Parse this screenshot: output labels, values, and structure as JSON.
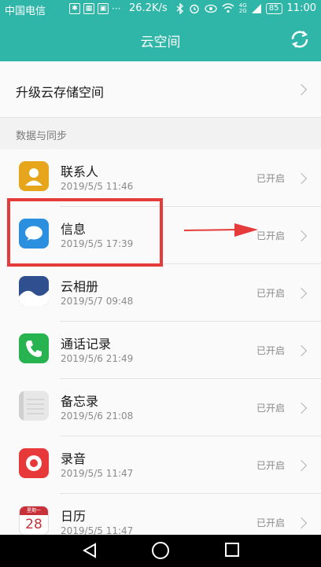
{
  "status_bar": {
    "carrier": "中国电信",
    "speed": "26.2K/s",
    "network": "4G 2G",
    "battery": "85",
    "time": "11:00"
  },
  "app_bar": {
    "title": "云空间",
    "sync_icon": "refresh-icon"
  },
  "upgrade": {
    "label": "升级云存储空间"
  },
  "section": {
    "label": "数据与同步"
  },
  "items": [
    {
      "name": "联系人",
      "time": "2019/5/5 11:46",
      "status": "已开启",
      "icon": "contacts-icon",
      "color": "#e6a51b"
    },
    {
      "name": "信息",
      "time": "2019/5/5 17:39",
      "status": "已开启",
      "icon": "message-icon",
      "color": "#2b8fe0"
    },
    {
      "name": "云相册",
      "time": "2019/5/7 09:48",
      "status": "已开启",
      "icon": "gallery-icon",
      "color": "#2f4f8f"
    },
    {
      "name": "通话记录",
      "time": "2019/5/6 21:49",
      "status": "已开启",
      "icon": "phone-icon",
      "color": "#27b34f"
    },
    {
      "name": "备忘录",
      "time": "2019/5/6 21:08",
      "status": "已开启",
      "icon": "notepad-icon",
      "color": "#e7e7e7"
    },
    {
      "name": "录音",
      "time": "2019/5/5 11:47",
      "status": "已开启",
      "icon": "recorder-icon",
      "color": "#e8393a"
    },
    {
      "name": "日历",
      "time": "2019/5/5 11:47",
      "status": "已开启",
      "icon": "calendar-icon",
      "color": "#c8313a",
      "icon_text_top": "星期一",
      "icon_text_day": "28"
    }
  ],
  "colors": {
    "accent": "#2fb6a8",
    "highlight": "#e63b3b"
  }
}
